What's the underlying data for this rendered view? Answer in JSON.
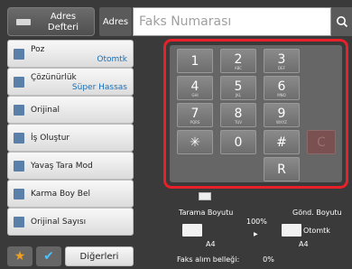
{
  "top": {
    "address_book_label": "Adres Defteri",
    "address_label": "Adres",
    "fax_number_placeholder": "Faks Numarası",
    "search_icon": "search-icon"
  },
  "menu": [
    {
      "label": "Poz",
      "value": "Otomtk",
      "icon": "exposure-icon"
    },
    {
      "label": "Çözünürlük",
      "value": "Süper Hassas",
      "icon": "resolution-icon"
    },
    {
      "label": "Orijinal",
      "value": "",
      "icon": "original-icon"
    },
    {
      "label": "İş Oluştur",
      "value": "",
      "icon": "job-build-icon"
    },
    {
      "label": "Yavaş Tara Mod",
      "value": "",
      "icon": "slow-scan-icon"
    },
    {
      "label": "Karma Boy Bel",
      "value": "",
      "icon": "mixed-size-icon"
    },
    {
      "label": "Orijinal Sayısı",
      "value": "",
      "icon": "original-count-icon"
    }
  ],
  "bottom_buttons": {
    "favorite_icon": "star-icon",
    "check_icon": "check-icon",
    "others_label": "Diğerleri"
  },
  "keypad": [
    {
      "digit": "1",
      "letters": ""
    },
    {
      "digit": "2",
      "letters": "ABC"
    },
    {
      "digit": "3",
      "letters": "DEF"
    },
    {
      "digit": "4",
      "letters": "GHI"
    },
    {
      "digit": "5",
      "letters": "JKL"
    },
    {
      "digit": "6",
      "letters": "MNO"
    },
    {
      "digit": "7",
      "letters": "PQRS"
    },
    {
      "digit": "8",
      "letters": "TUV"
    },
    {
      "digit": "9",
      "letters": "WXYZ"
    },
    {
      "digit": "✳",
      "letters": ""
    },
    {
      "digit": "0",
      "letters": ""
    },
    {
      "digit": "#",
      "letters": ""
    },
    {
      "digit": "C",
      "letters": ""
    },
    {
      "digit": "R",
      "letters": ""
    }
  ],
  "info": {
    "scan_size_label": "Tarama Boyutu",
    "send_size_label": "Gönd. Boyutu",
    "ratio": "100%",
    "send_size_value": "Otomtk",
    "scan_paper": "A4",
    "send_paper": "A4",
    "fax_memory_label": "Faks alım belleği:",
    "fax_memory_value": "0%"
  },
  "colors": {
    "highlight_frame": "#e8202a",
    "value_text": "#1c6fb5"
  }
}
